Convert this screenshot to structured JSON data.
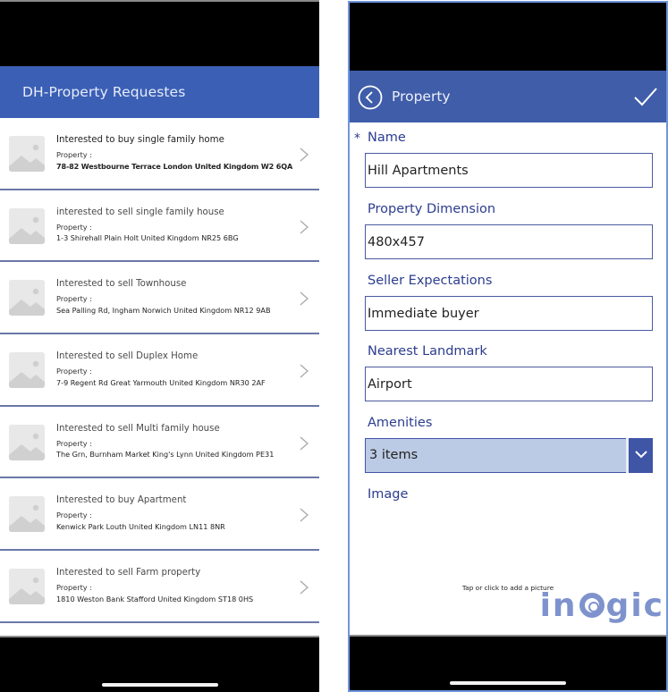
{
  "left_screen": {
    "header": {
      "title": "DH-Property Requestes"
    },
    "property_label": "Property :",
    "items": [
      {
        "title": "Interested to buy single family home",
        "address": "78-82 Westbourne Terrace London United Kingdom W2 6QA"
      },
      {
        "title": "interested to sell single family house",
        "address": "1-3 Shirehall Plain Holt United Kingdom NR25 6BG"
      },
      {
        "title": "Interested to sell Townhouse",
        "address": "Sea Palling Rd, Ingham Norwich United Kingdom NR12 9AB"
      },
      {
        "title": "Interested to sell Duplex Home",
        "address": "7-9 Regent Rd Great Yarmouth United Kingdom NR30 2AF"
      },
      {
        "title": "Interested to sell Multi family house",
        "address": "The Grn, Burnham Market  King's Lynn United Kingdom PE31"
      },
      {
        "title": "Interested to buy Apartment",
        "address": "Kenwick Park Louth United Kingdom LN11 8NR"
      },
      {
        "title": "Interested to sell Farm property",
        "address": "1810 Weston Bank Stafford United Kingdom ST18 0HS"
      }
    ]
  },
  "right_screen": {
    "header": {
      "title": "Property",
      "back_icon": "chevron-left-circle-icon",
      "submit_icon": "checkmark-icon"
    },
    "form": {
      "name": {
        "label": "Name",
        "required_marker": "*",
        "value": "Hill Apartments"
      },
      "property_dimension": {
        "label": "Property Dimension",
        "value": "480x457"
      },
      "seller_expectations": {
        "label": "Seller Expectations",
        "value": "Immediate buyer"
      },
      "nearest_landmark": {
        "label": "Nearest Landmark",
        "value": "Airport"
      },
      "amenities": {
        "label": "Amenities",
        "value": "3 items"
      },
      "image": {
        "label": "Image",
        "hint": "Tap or click to add a picture"
      }
    }
  },
  "watermark": {
    "text_before": "in",
    "text_after": "gic"
  },
  "colors": {
    "left_header_bg": "#3a5fb5",
    "right_header_bg": "#3f5da9",
    "label_color": "#2c3d8f",
    "dropdown_bg": "#bccbe5",
    "dropdown_toggle_bg": "#3f55a6",
    "divider": "#6a78a8",
    "frame_border": "#6f95dd",
    "watermark": "#7489c9"
  }
}
